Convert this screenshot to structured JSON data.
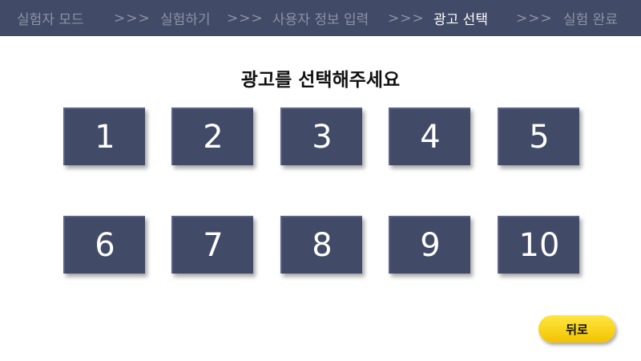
{
  "steps": [
    {
      "label": "실험자 모드",
      "active": false
    },
    {
      "label": "실험하기",
      "active": false
    },
    {
      "label": "사용자 정보 입력",
      "active": false
    },
    {
      "label": "광고 선택",
      "active": true
    },
    {
      "label": "실험 완료",
      "active": false
    }
  ],
  "separator": ">>>",
  "title": "광고를 선택해주세요",
  "ads": [
    "1",
    "2",
    "3",
    "4",
    "5",
    "6",
    "7",
    "8",
    "9",
    "10"
  ],
  "back_label": "뒤로",
  "colors": {
    "topbar": "#414a66",
    "ad_button": "#414a66",
    "back_button": "#f5cc00",
    "active_step": "#ffffff",
    "inactive_step": "#8c93a6"
  }
}
